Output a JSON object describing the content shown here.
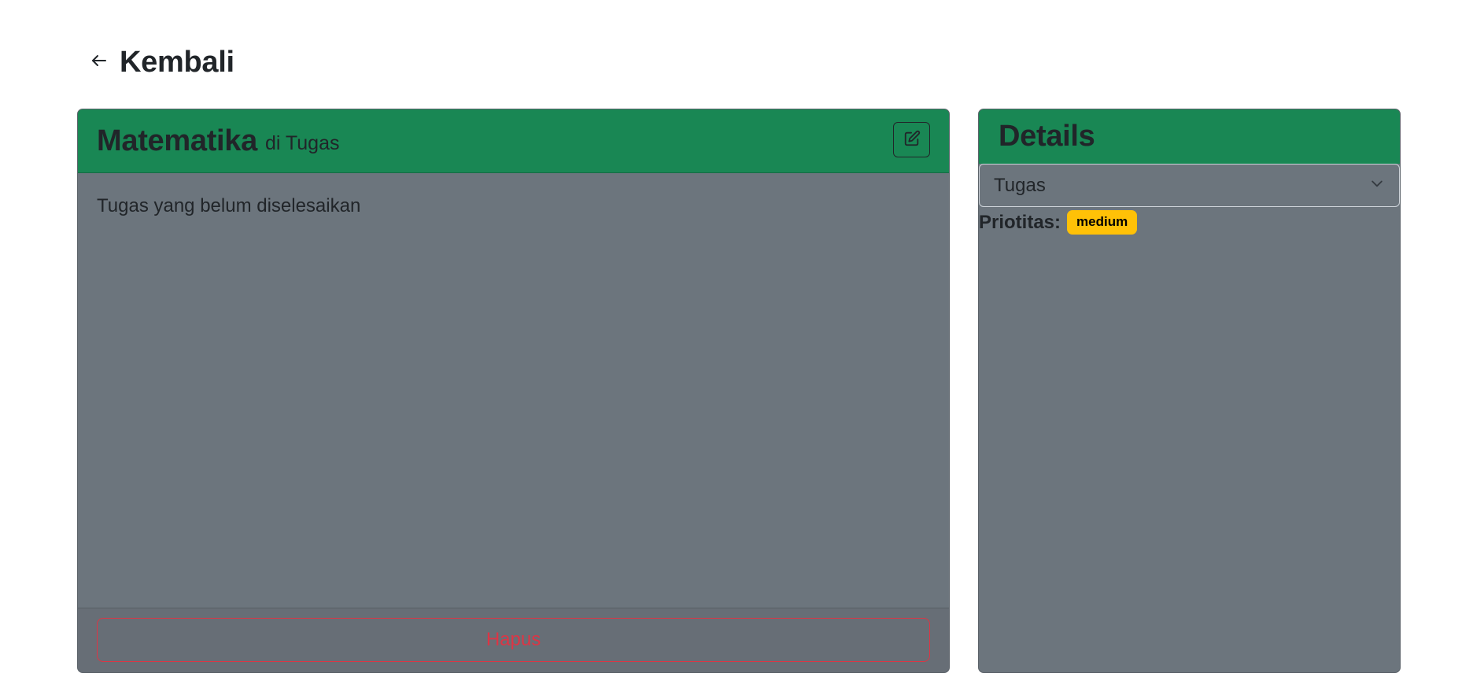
{
  "nav": {
    "back_label": "Kembali"
  },
  "task": {
    "title": "Matematika",
    "subtitle": "di Tugas",
    "description": "Tugas yang belum diselesaikan",
    "delete_label": "Hapus"
  },
  "details": {
    "title": "Details",
    "category_selected": "Tugas",
    "priority_label": "Priotitas:",
    "priority_value": "medium"
  },
  "colors": {
    "header_green": "#198754",
    "card_gray": "#6c757d",
    "danger": "#dc3545",
    "warning": "#ffc107"
  },
  "icons": {
    "back": "arrow-left-icon",
    "edit": "pencil-square-icon",
    "select": "chevron-down-icon"
  }
}
